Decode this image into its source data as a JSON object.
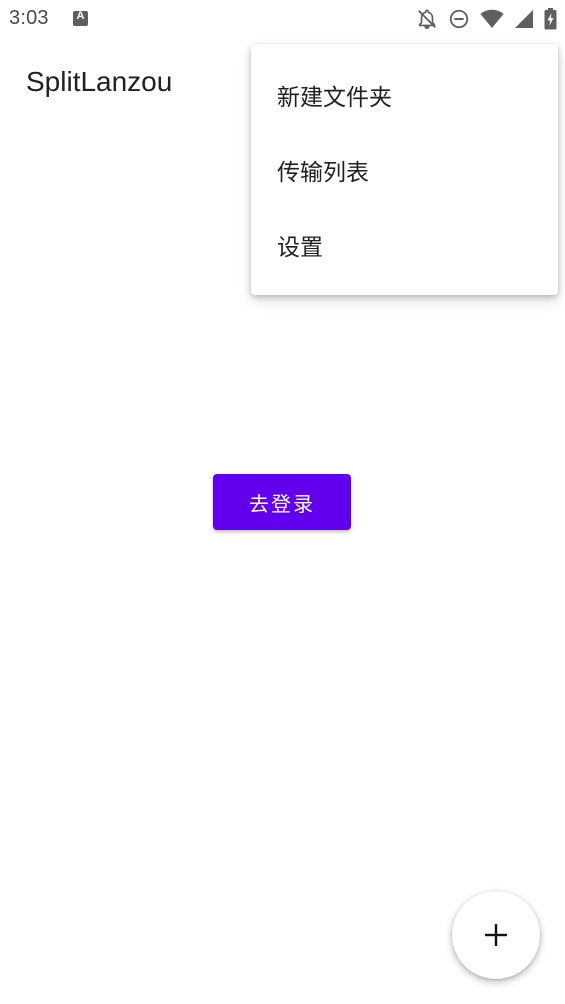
{
  "status_bar": {
    "time": "3:03",
    "icons": [
      "notification-a-icon",
      "bell-off-icon",
      "do-not-disturb-icon",
      "wifi-icon",
      "signal-icon",
      "battery-charging-icon"
    ]
  },
  "app_bar": {
    "title": "SplitLanzou"
  },
  "overflow_menu": {
    "items": [
      {
        "label": "新建文件夹"
      },
      {
        "label": "传输列表"
      },
      {
        "label": "设置"
      }
    ]
  },
  "main": {
    "login_label": "去登录"
  },
  "fab": {
    "icon": "plus-icon"
  },
  "colors": {
    "accent": "#6200ee",
    "text_primary": "#212121",
    "status_icon": "#5f5f5f"
  }
}
